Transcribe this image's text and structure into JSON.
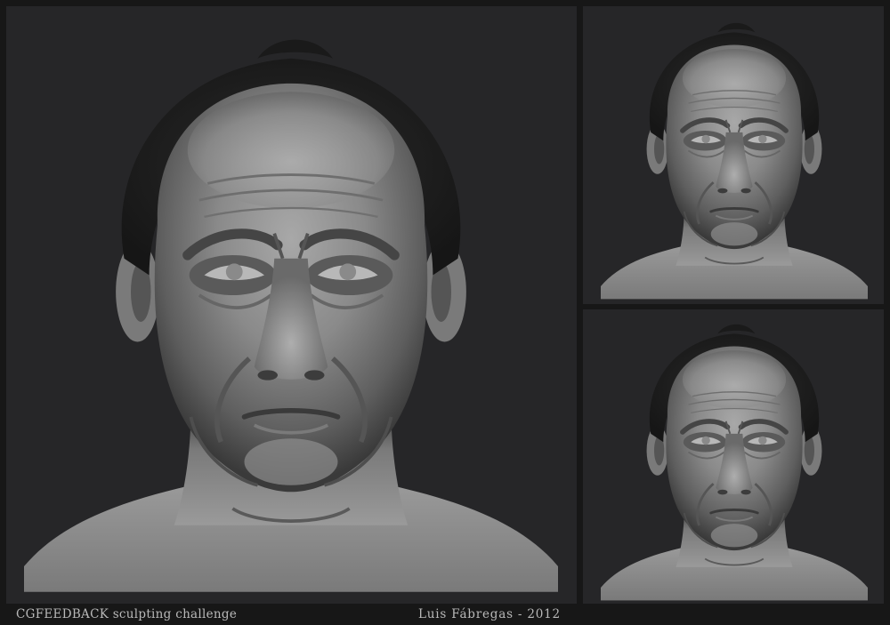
{
  "caption": {
    "left": "CGFEEDBACK sculpting challenge",
    "right": "Luis Fábregas - 2012"
  },
  "colors": {
    "background": "#262628",
    "frame": "#171717",
    "caption_text": "#b9b9b9",
    "clay_light": "#a9a9a9",
    "clay_mid": "#6e6e6e",
    "clay_dark": "#2e2e2e",
    "hair": "#1e1e1e"
  },
  "image": {
    "subject": "digital clay sculpt of an older man's head and neck",
    "views": [
      "front view (large)",
      "three-quarter front view",
      "front view, slightly lower angle"
    ]
  }
}
